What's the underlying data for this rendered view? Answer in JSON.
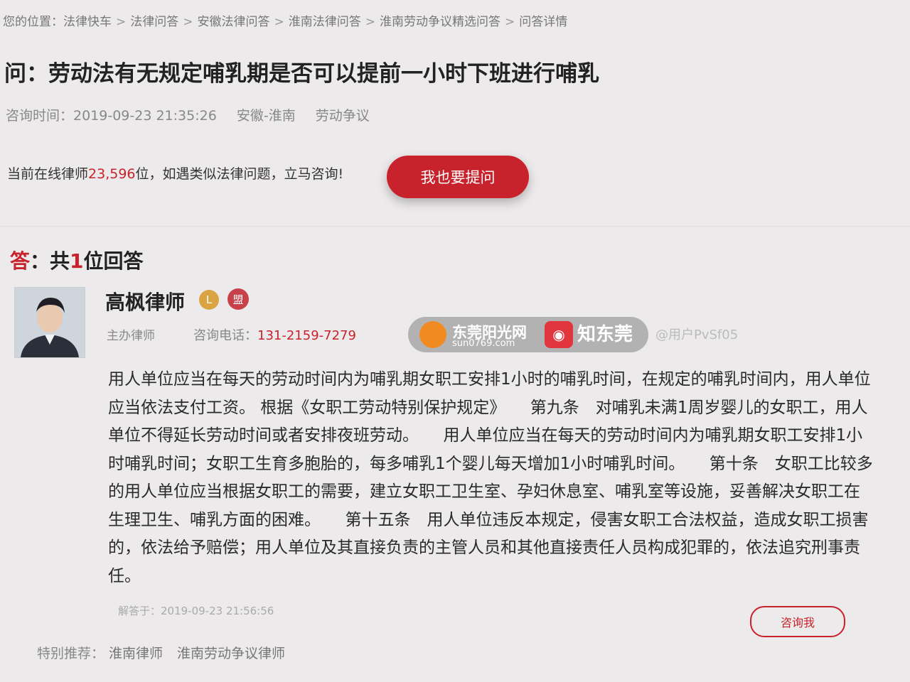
{
  "breadcrumb": {
    "prefix": "您的位置：",
    "items": [
      "法律快车",
      "法律问答",
      "安徽法律问答",
      "淮南法律问答",
      "淮南劳动争议精选问答",
      "问答详情"
    ]
  },
  "question": {
    "title": "问：劳动法有无规定哺乳期是否可以提前一小时下班进行哺乳",
    "time": "咨询时间：2019-09-23 21:35:26",
    "location": "安徽-淮南",
    "category": "劳动争议"
  },
  "cta": {
    "pre": "当前在线律师",
    "count": "23,596",
    "post": "位，如遇类似法律问题，立马咨询!",
    "ask_button": "我也要提问"
  },
  "answers": {
    "heading_lead": "答",
    "heading_mid": "：共",
    "count": "1",
    "heading_post": "位回答"
  },
  "lawyer": {
    "name": "高枫律师",
    "badge_gold": "L",
    "badge_red": "盟",
    "role": "主办律师",
    "phone_label": "咨询电话：",
    "phone": "131-2159-7279"
  },
  "watermark": {
    "site": "东莞阳光网",
    "url": "sun0769.com",
    "brand": "知东莞",
    "brand_icon": "◉",
    "user": "@用户PvSf05"
  },
  "answer": {
    "body": "用人单位应当在每天的劳动时间内为哺乳期女职工安排1小时的哺乳时间，在规定的哺乳时间内，用人单位应当依法支付工资。 根据《女职工劳动特别保护规定》　　第九条　对哺乳未满1周岁婴儿的女职工，用人单位不得延长劳动时间或者安排夜班劳动。　　用人单位应当在每天的劳动时间内为哺乳期女职工安排1小时哺乳时间；女职工生育多胞胎的，每多哺乳1个婴儿每天增加1小时哺乳时间。　　第十条　女职工比较多的用人单位应当根据女职工的需要，建立女职工卫生室、孕妇休息室、哺乳室等设施，妥善解决女职工在生理卫生、哺乳方面的困难。　　第十五条　用人单位违反本规定，侵害女职工合法权益，造成女职工损害的，依法给予赔偿；用人单位及其直接负责的主管人员和其他直接责任人员构成犯罪的，依法追究刑事责任。",
    "answered_at": "解答于：2019-09-23 21:56:56",
    "consult_button": "咨询我"
  },
  "recommend": {
    "label": "特别推荐：",
    "links": [
      "淮南律师",
      "淮南劳动争议律师"
    ]
  },
  "colors": {
    "accent": "#c8232c"
  }
}
